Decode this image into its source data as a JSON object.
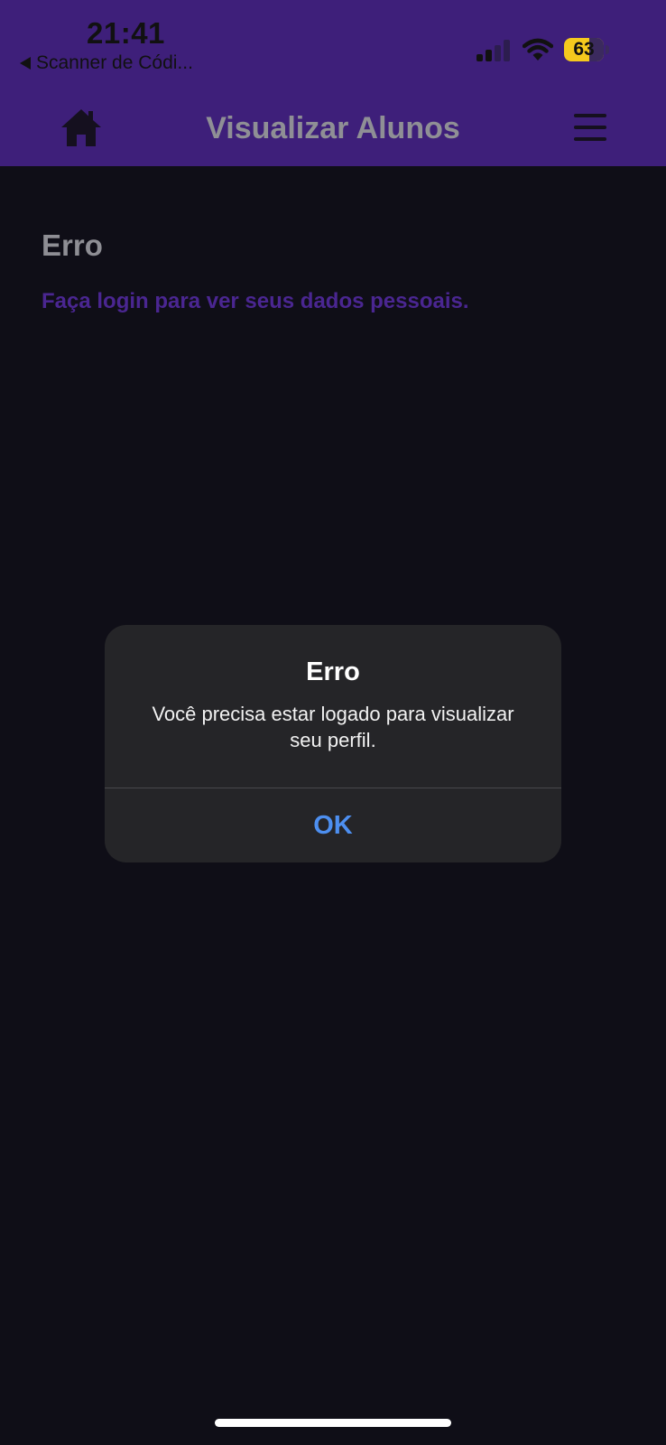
{
  "status_bar": {
    "time": "21:41",
    "back_app_label": "Scanner de Códi...",
    "battery_level": "63",
    "battery_fraction": 0.63
  },
  "header": {
    "title": "Visualizar Alunos",
    "home_icon": "home-icon",
    "menu_icon": "hamburger-menu-icon"
  },
  "main": {
    "heading": "Erro",
    "message": "Faça login para ver seus dados pessoais."
  },
  "alert": {
    "title": "Erro",
    "message": "Você precisa estar logado para visualizar seu perfil.",
    "ok_label": "OK"
  },
  "colors": {
    "header_bg": "#3e1f7a",
    "page_bg": "#0f0e17",
    "link_purple": "#4a2691",
    "alert_bg": "#252528",
    "alert_button": "#4d8ff0",
    "battery": "#f5c91d"
  }
}
